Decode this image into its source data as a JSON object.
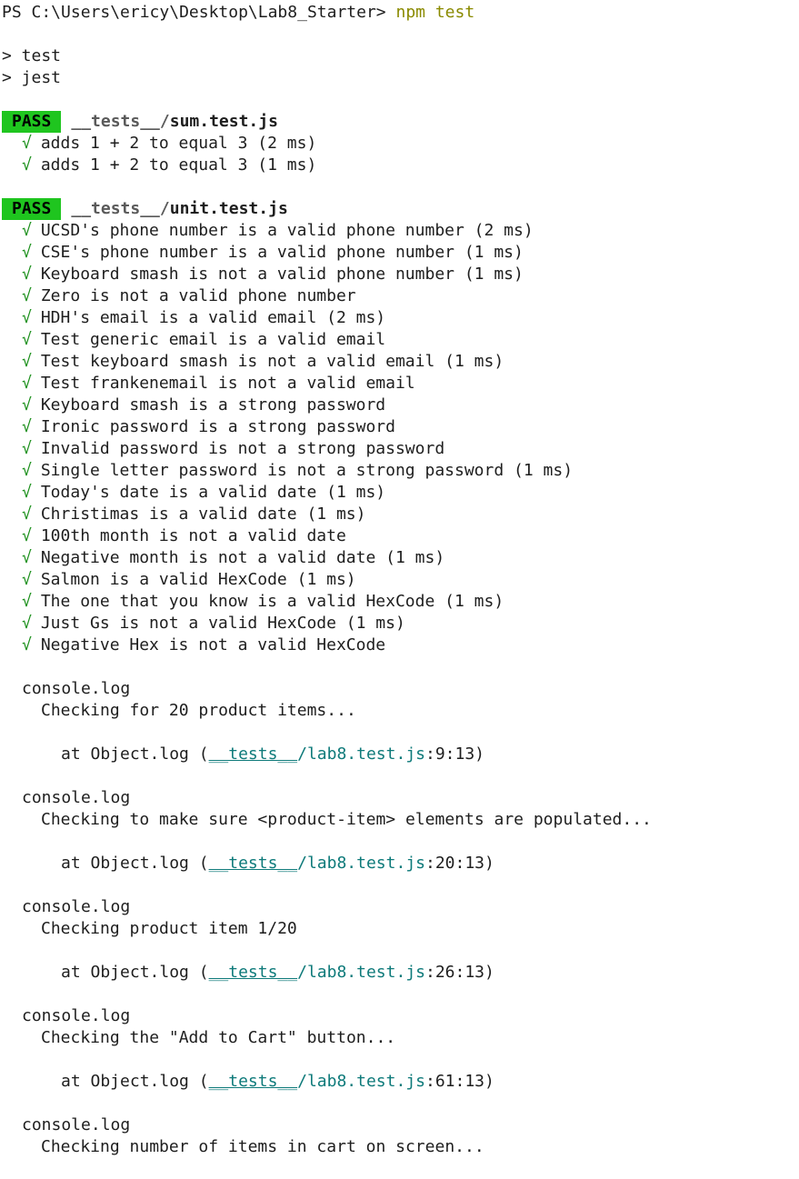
{
  "prompt": {
    "path": "PS C:\\Users\\ericy\\Desktop\\Lab8_Starter>",
    "command": "npm test"
  },
  "script_lines": [
    "> test",
    "> jest"
  ],
  "suites": [
    {
      "status": "PASS",
      "dir": "__tests__/",
      "file": "sum.test.js",
      "tests": [
        {
          "mark": "√",
          "text": "adds 1 + 2 to equal 3 (2 ms)"
        },
        {
          "mark": "√",
          "text": "adds 1 + 2 to equal 3 (1 ms)"
        }
      ]
    },
    {
      "status": "PASS",
      "dir": "__tests__/",
      "file": "unit.test.js",
      "tests": [
        {
          "mark": "√",
          "text": "UCSD's phone number is a valid phone number (2 ms)"
        },
        {
          "mark": "√",
          "text": "CSE's phone number is a valid phone number (1 ms)"
        },
        {
          "mark": "√",
          "text": "Keyboard smash is not a valid phone number (1 ms)"
        },
        {
          "mark": "√",
          "text": "Zero is not a valid phone number"
        },
        {
          "mark": "√",
          "text": "HDH's email is a valid email (2 ms)"
        },
        {
          "mark": "√",
          "text": "Test generic email is a valid email"
        },
        {
          "mark": "√",
          "text": "Test keyboard smash is not a valid email (1 ms)"
        },
        {
          "mark": "√",
          "text": "Test frankenemail is not a valid email"
        },
        {
          "mark": "√",
          "text": "Keyboard smash is a strong password"
        },
        {
          "mark": "√",
          "text": "Ironic password is a strong password"
        },
        {
          "mark": "√",
          "text": "Invalid password is not a strong password"
        },
        {
          "mark": "√",
          "text": "Single letter password is not a strong password (1 ms)"
        },
        {
          "mark": "√",
          "text": "Today's date is a valid date (1 ms)"
        },
        {
          "mark": "√",
          "text": "Christimas is a valid date (1 ms)"
        },
        {
          "mark": "√",
          "text": "100th month is not a valid date"
        },
        {
          "mark": "√",
          "text": "Negative month is not a valid date (1 ms)"
        },
        {
          "mark": "√",
          "text": "Salmon is a valid HexCode (1 ms)"
        },
        {
          "mark": "√",
          "text": "The one that you know is a valid HexCode (1 ms)"
        },
        {
          "mark": "√",
          "text": "Just Gs is not a valid HexCode (1 ms)"
        },
        {
          "mark": "√",
          "text": "Negative Hex is not a valid HexCode"
        }
      ]
    }
  ],
  "logs": [
    {
      "label": "console.log",
      "message": "Checking for 20 product items...",
      "at_prefix": "at Object.log (",
      "at_dir": "__tests__",
      "at_file": "/lab8.test.js",
      "at_pos": ":9:13)"
    },
    {
      "label": "console.log",
      "message": "Checking to make sure <product-item> elements are populated...",
      "at_prefix": "at Object.log (",
      "at_dir": "__tests__",
      "at_file": "/lab8.test.js",
      "at_pos": ":20:13)"
    },
    {
      "label": "console.log",
      "message": "Checking product item 1/20",
      "at_prefix": "at Object.log (",
      "at_dir": "__tests__",
      "at_file": "/lab8.test.js",
      "at_pos": ":26:13)"
    },
    {
      "label": "console.log",
      "message": "Checking the \"Add to Cart\" button...",
      "at_prefix": "at Object.log (",
      "at_dir": "__tests__",
      "at_file": "/lab8.test.js",
      "at_pos": ":61:13)"
    },
    {
      "label": "console.log",
      "message": "Checking number of items in cart on screen...",
      "at_prefix": null,
      "at_dir": null,
      "at_file": null,
      "at_pos": null
    }
  ],
  "colors": {
    "pass_badge_bg": "#1fc51f",
    "check_mark": "#1a8f1a",
    "command": "#8a8a00",
    "link": "#0e7a7a"
  }
}
